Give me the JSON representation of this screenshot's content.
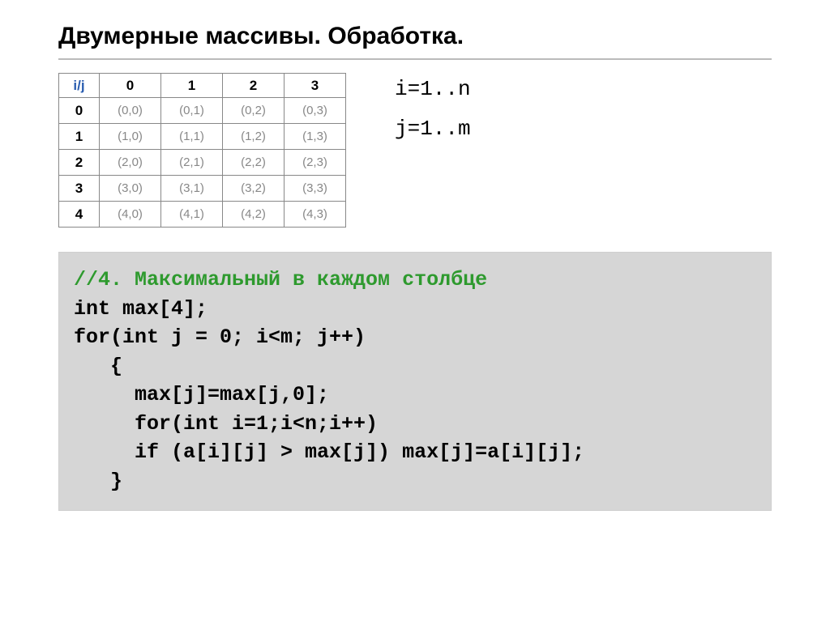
{
  "title": "Двумерные массивы. Обработка.",
  "table": {
    "corner": "i/j",
    "cols": [
      "0",
      "1",
      "2",
      "3"
    ],
    "rows": [
      "0",
      "1",
      "2",
      "3",
      "4"
    ],
    "cells": [
      [
        "(0,0)",
        "(0,1)",
        "(0,2)",
        "(0,3)"
      ],
      [
        "(1,0)",
        "(1,1)",
        "(1,2)",
        "(1,3)"
      ],
      [
        "(2,0)",
        "(2,1)",
        "(2,2)",
        "(2,3)"
      ],
      [
        "(3,0)",
        "(3,1)",
        "(3,2)",
        "(3,3)"
      ],
      [
        "(4,0)",
        "(4,1)",
        "(4,2)",
        "(4,3)"
      ]
    ]
  },
  "loops": {
    "i": "i=1..n",
    "j": "j=1..m"
  },
  "code": {
    "comment": "//4. Максимальный в каждом столбце",
    "l1": "int max[4];",
    "l2": "for(int j = 0; i<m; j++)",
    "l3": "   {",
    "l4": "     max[j]=max[j,0];",
    "l5": "     for(int i=1;i<n;i++)",
    "l6": "     if (a[i][j] > max[j]) max[j]=a[i][j];",
    "l7": "   }"
  }
}
